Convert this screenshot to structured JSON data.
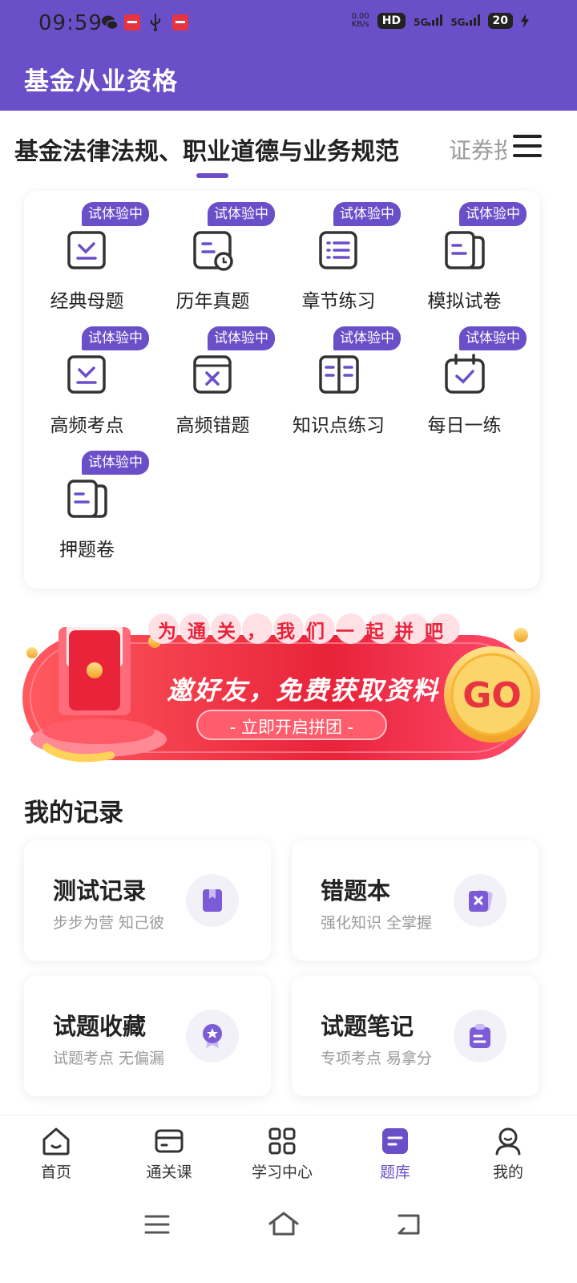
{
  "status_bar": {
    "time": "09:59",
    "net_speed": "0.00\nKB/s",
    "net_top": "0.00",
    "net_bottom": "KB/s",
    "hd": "HD",
    "signal1": "5G",
    "signal2": "5G",
    "battery": "20"
  },
  "header": {
    "title": "基金从业资格"
  },
  "tabs": {
    "active": "基金法律法规、职业道德与业务规范",
    "next": "证券投"
  },
  "grid": {
    "badge": "试体验中",
    "items": [
      {
        "label": "经典母题",
        "icon": "check-doc-icon"
      },
      {
        "label": "历年真题",
        "icon": "clock-doc-icon"
      },
      {
        "label": "章节练习",
        "icon": "list-icon"
      },
      {
        "label": "模拟试卷",
        "icon": "paper-icon"
      },
      {
        "label": "高频考点",
        "icon": "check-doc-icon"
      },
      {
        "label": "高频错题",
        "icon": "x-doc-icon"
      },
      {
        "label": "知识点练习",
        "icon": "book-icon"
      },
      {
        "label": "每日一练",
        "icon": "calendar-check-icon"
      },
      {
        "label": "押题卷",
        "icon": "paper-icon"
      }
    ]
  },
  "banner": {
    "top_text": "为通关，我们一起拼吧",
    "main_text": "邀好友，免费获取资料",
    "button_text": "- 立即开启拼团 -",
    "go": "GO"
  },
  "records": {
    "title": "我的记录",
    "cards": [
      {
        "title": "测试记录",
        "subtitle": "步步为营 知己彼",
        "icon": "bookmark-icon"
      },
      {
        "title": "错题本",
        "subtitle": "强化知识 全掌握",
        "icon": "wrong-book-icon"
      },
      {
        "title": "试题收藏",
        "subtitle": "试题考点 无偏漏",
        "icon": "star-badge-icon"
      },
      {
        "title": "试题笔记",
        "subtitle": "专项考点 易拿分",
        "icon": "clipboard-icon"
      }
    ]
  },
  "bottom_nav": {
    "items": [
      {
        "label": "首页"
      },
      {
        "label": "通关课"
      },
      {
        "label": "学习中心"
      },
      {
        "label": "题库"
      },
      {
        "label": "我的"
      }
    ],
    "active_index": 3
  },
  "colors": {
    "primary": "#6a4fc8",
    "banner_red": "#e8343f",
    "gold": "#f2b233"
  }
}
